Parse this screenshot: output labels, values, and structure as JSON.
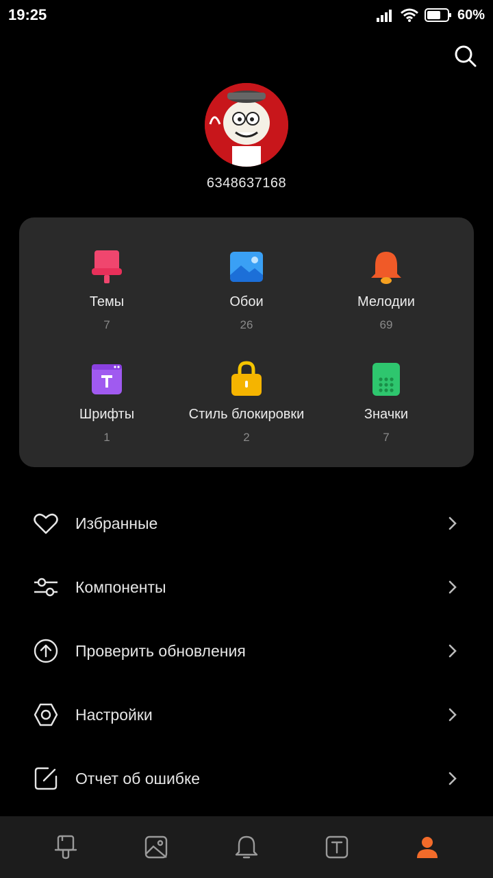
{
  "status_bar": {
    "time": "19:25",
    "battery": "60%"
  },
  "search": {
    "icon": "search-icon"
  },
  "profile": {
    "user_id": "6348637168",
    "avatar_bg": "#c8161b"
  },
  "categories": [
    {
      "label": "Темы",
      "count": "7",
      "icon": "themes-icon",
      "color": "#f0466e"
    },
    {
      "label": "Обои",
      "count": "26",
      "icon": "wallpaper-icon",
      "color": "#2d8cf0"
    },
    {
      "label": "Мелодии",
      "count": "69",
      "icon": "bell-icon",
      "color": "#f05a28"
    },
    {
      "label": "Шрифты",
      "count": "1",
      "icon": "font-icon",
      "color": "#a05af0"
    },
    {
      "label": "Стиль блокировки",
      "count": "2",
      "icon": "lock-icon",
      "color": "#f5b400"
    },
    {
      "label": "Значки",
      "count": "7",
      "icon": "app-icons-icon",
      "color": "#2ec66e"
    }
  ],
  "menu": [
    {
      "label": "Избранные",
      "icon": "heart-icon"
    },
    {
      "label": "Компоненты",
      "icon": "sliders-icon"
    },
    {
      "label": "Проверить обновления",
      "icon": "update-arrow-icon"
    },
    {
      "label": "Настройки",
      "icon": "settings-icon"
    },
    {
      "label": "Отчет об ошибке",
      "icon": "edit-report-icon"
    }
  ],
  "bottom_nav": [
    {
      "name": "themes",
      "icon": "brush-icon",
      "active": false
    },
    {
      "name": "wallpapers",
      "icon": "image-icon",
      "active": false
    },
    {
      "name": "ringtones",
      "icon": "bell-icon",
      "active": false
    },
    {
      "name": "fonts",
      "icon": "font-icon",
      "active": false
    },
    {
      "name": "profile",
      "icon": "person-icon",
      "active": true
    }
  ],
  "colors": {
    "accent": "#f26b2a",
    "card_bg": "#2a2a2a",
    "background": "#000000"
  }
}
